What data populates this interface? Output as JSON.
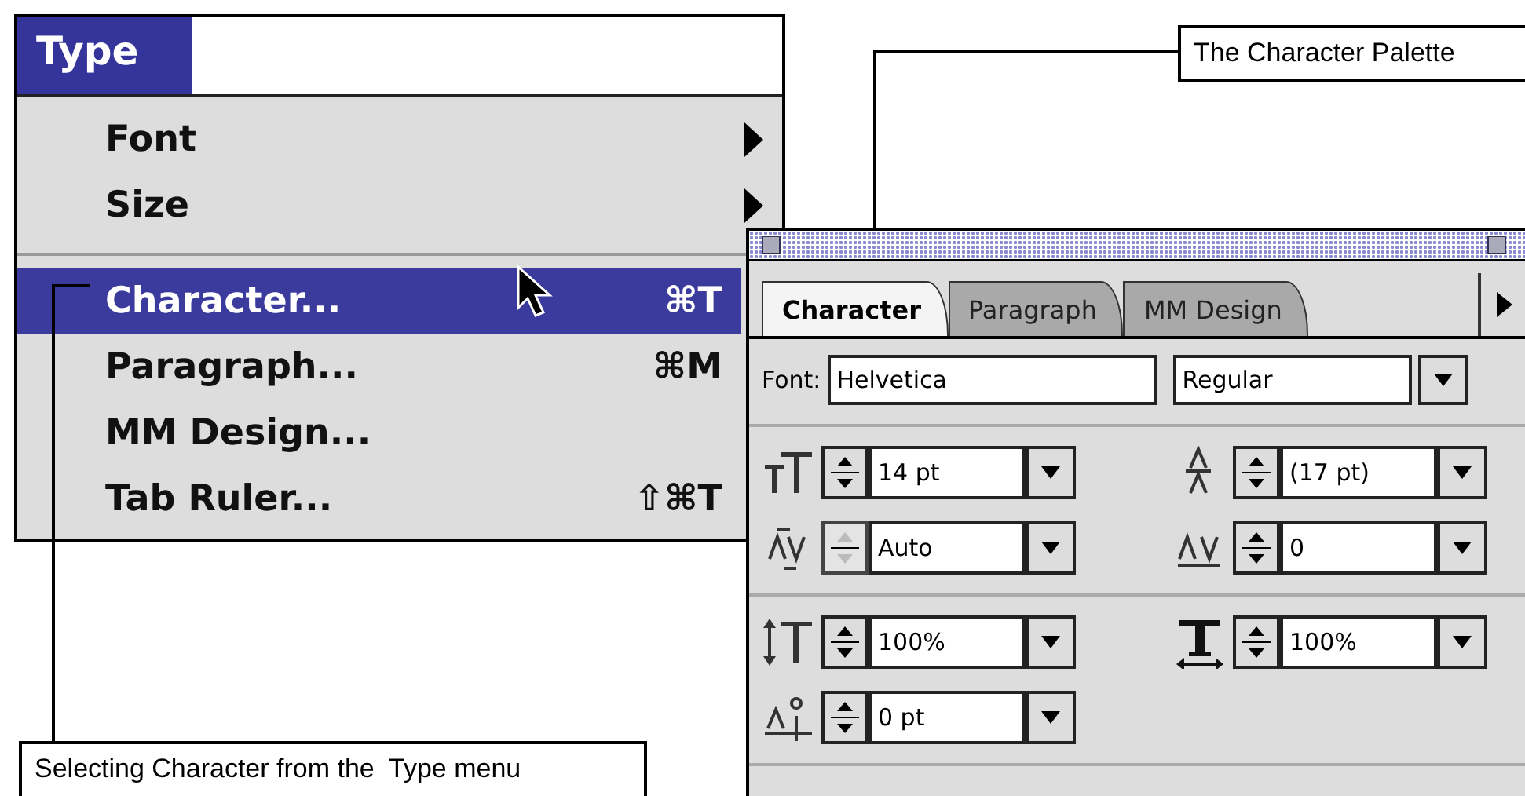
{
  "menu": {
    "title": "Type",
    "items": [
      {
        "kind": "submenu",
        "label": "Font",
        "selected": false
      },
      {
        "kind": "submenu",
        "label": "Size",
        "selected": false
      },
      {
        "kind": "separator"
      },
      {
        "kind": "command",
        "label": "Character...",
        "shortcut": "⌘T",
        "selected": true
      },
      {
        "kind": "command",
        "label": "Paragraph...",
        "shortcut": "⌘M",
        "selected": false
      },
      {
        "kind": "command",
        "label": "MM Design...",
        "selected": false
      },
      {
        "kind": "command",
        "label": "Tab Ruler...",
        "shortcut": "⇧⌘T",
        "selected": false
      }
    ]
  },
  "palette": {
    "tabs": [
      {
        "label": "Character",
        "selected": true
      },
      {
        "label": "Paragraph",
        "selected": false
      },
      {
        "label": "MM Design",
        "selected": false
      }
    ],
    "font": {
      "label": "Font:",
      "family": "Helvetica",
      "style": "Regular"
    },
    "groups": [
      [
        {
          "kind": "size",
          "value": "14 pt",
          "disabled": false
        },
        {
          "kind": "leading",
          "value": "(17 pt)",
          "disabled": false
        },
        {
          "kind": "kerning",
          "value": "Auto",
          "disabled": true
        },
        {
          "kind": "tracking",
          "value": "0",
          "disabled": false
        }
      ],
      [
        {
          "kind": "vscale",
          "value": "100%",
          "disabled": false
        },
        {
          "kind": "hscale",
          "value": "100%",
          "disabled": false
        },
        {
          "kind": "baseline",
          "value": "0 pt",
          "disabled": false
        }
      ]
    ]
  },
  "callouts": [
    {
      "kind": "palette",
      "text": "The Character Palette"
    },
    {
      "kind": "menu",
      "text": "Selecting Character from the  Type menu"
    }
  ]
}
